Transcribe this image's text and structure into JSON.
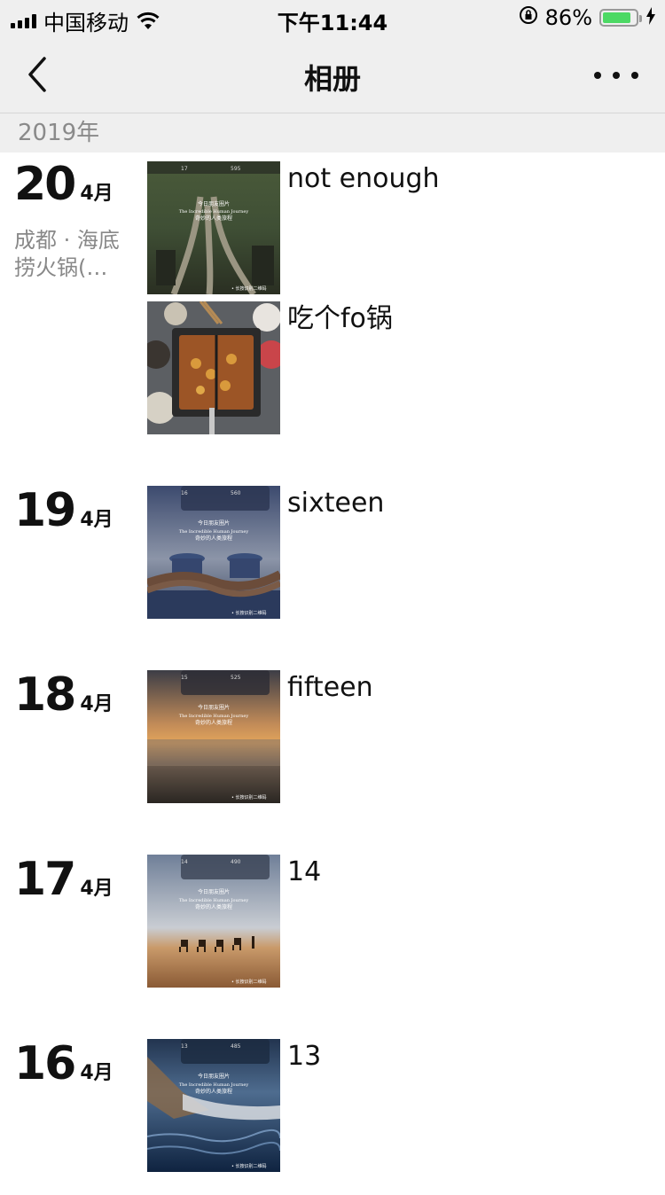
{
  "status_bar": {
    "carrier": "中国移动",
    "time": "下午11:44",
    "battery_percent": "86%",
    "battery_level": 0.86
  },
  "nav": {
    "title": "相册"
  },
  "year_header": "2019年",
  "entries": [
    {
      "day": "20",
      "month": "4月",
      "location": "成都 · 海底捞火锅(…",
      "posts": [
        {
          "text": "not enough",
          "thumb": "ruins-tree-card"
        },
        {
          "text": "吃个fo锅",
          "thumb": "hotpot-photo"
        }
      ]
    },
    {
      "day": "19",
      "month": "4月",
      "location": "",
      "posts": [
        {
          "text": "sixteen",
          "thumb": "rope-bollard-card"
        }
      ]
    },
    {
      "day": "18",
      "month": "4月",
      "location": "",
      "posts": [
        {
          "text": "fifteen",
          "thumb": "sunset-water-card"
        }
      ]
    },
    {
      "day": "17",
      "month": "4月",
      "location": "",
      "posts": [
        {
          "text": "14",
          "thumb": "desert-camels-card"
        }
      ]
    },
    {
      "day": "16",
      "month": "4月",
      "location": "",
      "posts": [
        {
          "text": "13",
          "thumb": "boat-water-card"
        }
      ]
    }
  ],
  "card_overlay": {
    "line1": "今日朋友圈片",
    "line2": "The Incredible Human Journey",
    "line3": "奇妙的人类旅程",
    "footer": "• 长按识别二维码"
  }
}
